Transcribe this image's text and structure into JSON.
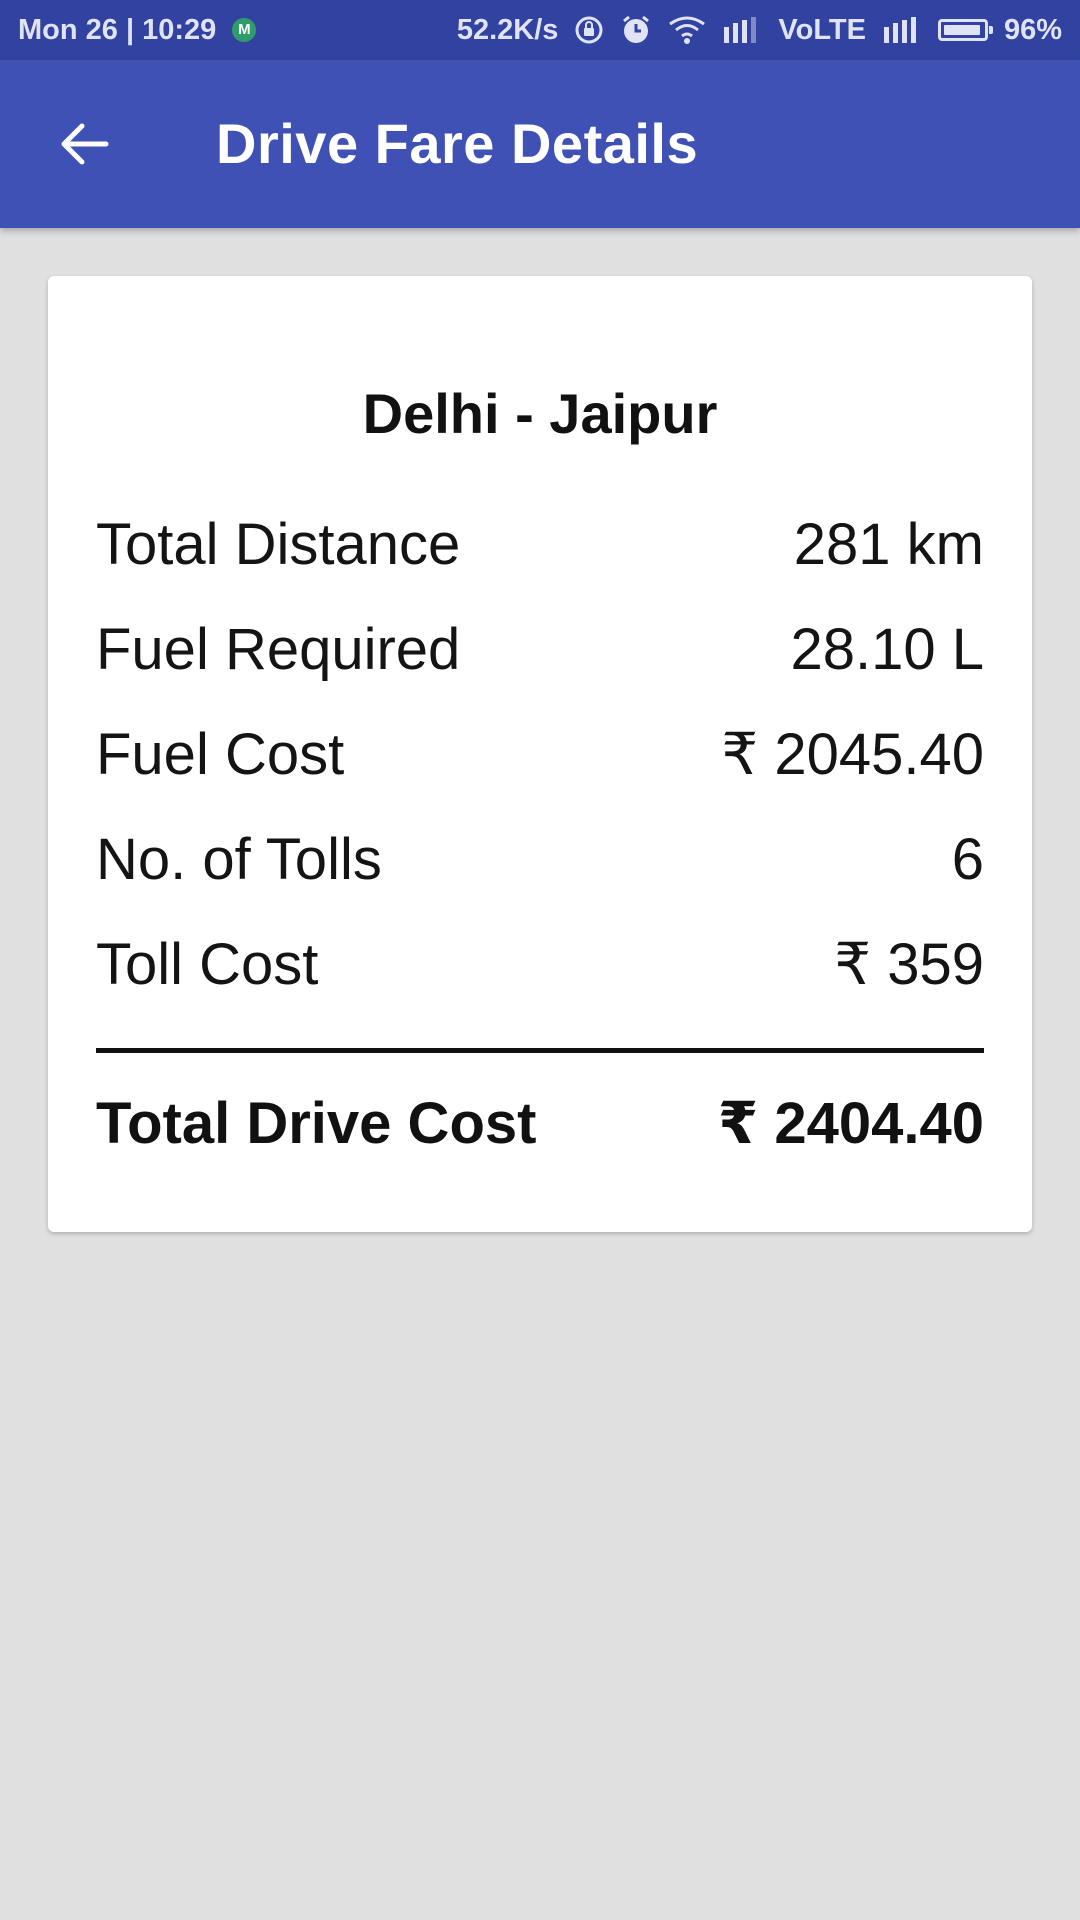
{
  "status_bar": {
    "datetime": "Mon 26 | 10:29",
    "app_badge": "M",
    "net_speed": "52.2K/s",
    "network_label": "VoLTE",
    "battery_percent": "96%",
    "battery_level": 0.96,
    "icons": [
      "rotation-lock-icon",
      "alarm-icon",
      "wifi-icon",
      "signal-icon",
      "signal-icon",
      "battery-icon"
    ]
  },
  "app_bar": {
    "back_icon": "arrow-back-icon",
    "title": "Drive Fare Details"
  },
  "card": {
    "route": "Delhi - Jaipur",
    "rows": [
      {
        "label": "Total Distance",
        "value": "281 km"
      },
      {
        "label": "Fuel Required",
        "value": "28.10 L"
      },
      {
        "label": "Fuel Cost",
        "value": "₹ 2045.40"
      },
      {
        "label": "No. of Tolls",
        "value": "6"
      },
      {
        "label": "Toll Cost",
        "value": "₹ 359"
      }
    ],
    "total": {
      "label": "Total Drive Cost",
      "value": "₹ 2404.40"
    }
  },
  "colors": {
    "status_bar": "#3242a0",
    "app_bar": "#3f51b5",
    "background": "#e0e0e0",
    "card": "#ffffff"
  }
}
